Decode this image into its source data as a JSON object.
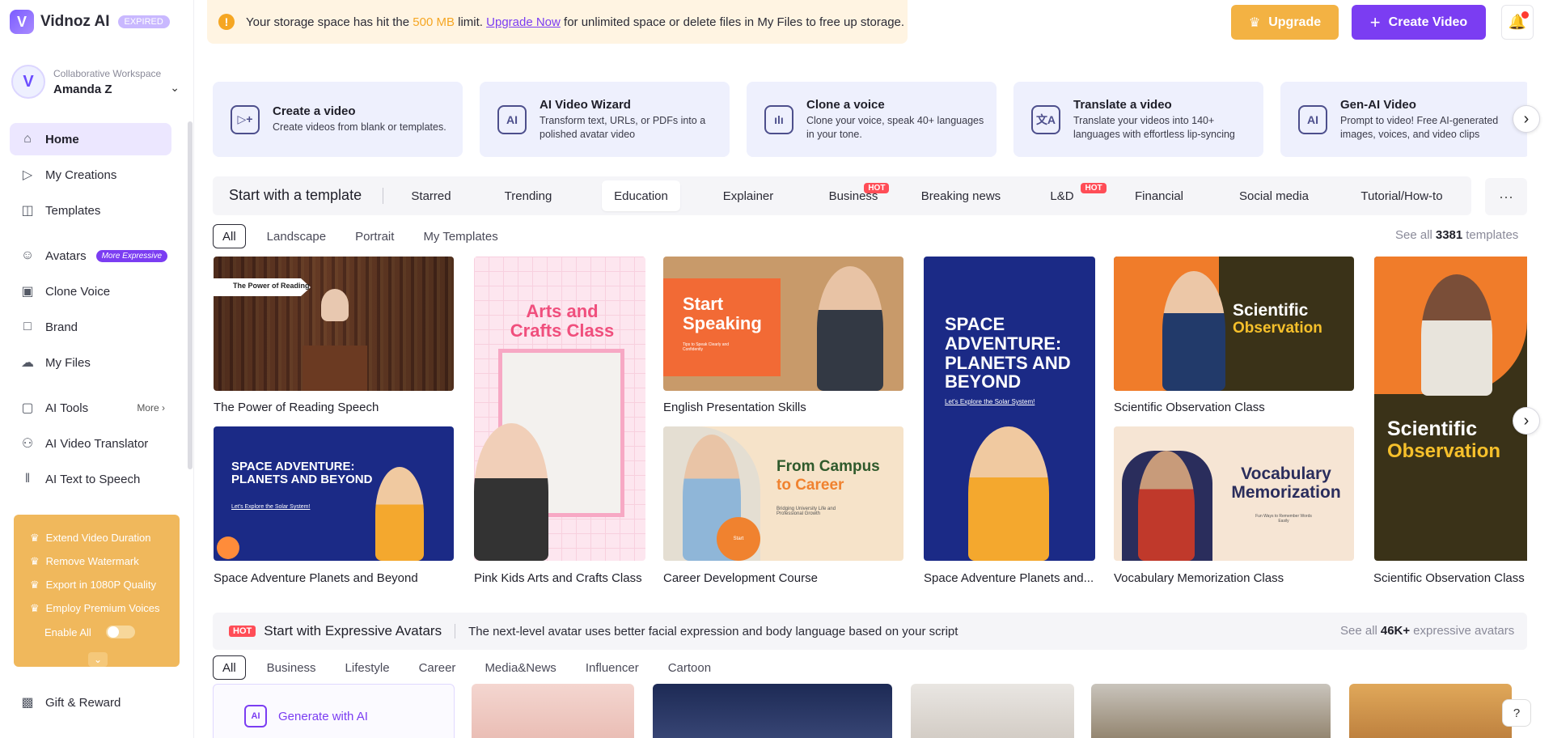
{
  "app": {
    "logo_text": "Vidnoz AI",
    "logo_mark": "V",
    "plan_badge": "EXPIRED",
    "workspace_label": "Collaborative Workspace",
    "workspace_user": "Amanda Z"
  },
  "sidebar": {
    "items": [
      {
        "label": "Home",
        "icon": "home-icon",
        "active": true
      },
      {
        "label": "My Creations",
        "icon": "play-square-icon"
      },
      {
        "label": "Templates",
        "icon": "templates-icon"
      },
      {
        "label": "Avatars",
        "icon": "avatar-icon",
        "badge": "More Expressive"
      },
      {
        "label": "Clone Voice",
        "icon": "voice-clone-icon"
      },
      {
        "label": "Brand",
        "icon": "brand-icon"
      },
      {
        "label": "My Files",
        "icon": "cloud-upload-icon"
      },
      {
        "label": "AI Tools",
        "icon": "ai-tools-icon",
        "more": "More"
      },
      {
        "label": "AI Video Translator",
        "icon": "translate-icon"
      },
      {
        "label": "AI Text to Speech",
        "icon": "waveform-icon"
      }
    ],
    "promo": {
      "items": [
        "Extend Video Duration",
        "Remove Watermark",
        "Export in 1080P Quality",
        "Employ Premium Voices"
      ],
      "toggle_label": "Enable All"
    },
    "gift_label": "Gift & Reward"
  },
  "notice": {
    "text_before": "Your storage space has hit the",
    "limit": "500 MB",
    "text_mid": "limit.",
    "link": "Upgrade Now",
    "text_after": "for unlimited space or delete files in My Files to free up storage."
  },
  "header": {
    "upgrade_label": "Upgrade",
    "create_label": "Create Video"
  },
  "features": [
    {
      "title": "Create a video",
      "desc": "Create videos from blank or templates.",
      "icon": "create-video-icon",
      "glyph": "▷+"
    },
    {
      "title": "AI Video Wizard",
      "desc": "Transform text, URLs, or PDFs into a polished avatar video",
      "icon": "ai-wizard-icon",
      "glyph": "AI"
    },
    {
      "title": "Clone a voice",
      "desc": "Clone your voice, speak 40+ languages in your tone.",
      "icon": "clone-voice-icon",
      "glyph": "ılı"
    },
    {
      "title": "Translate a video",
      "desc": "Translate your videos into 140+ languages with effortless lip-syncing",
      "icon": "translate-video-icon",
      "glyph": "文A"
    },
    {
      "title": "Gen-AI Video",
      "desc": "Prompt to video! Free AI-generated images, voices, and video clips",
      "icon": "gen-ai-video-icon",
      "glyph": "AI"
    }
  ],
  "templates": {
    "section_title": "Start with a template",
    "tabs": [
      {
        "label": "Starred"
      },
      {
        "label": "Trending"
      },
      {
        "label": "Education",
        "active": true
      },
      {
        "label": "Explainer"
      },
      {
        "label": "Business",
        "hot": "HOT"
      },
      {
        "label": "Breaking news"
      },
      {
        "label": "L&D",
        "hot": "HOT"
      },
      {
        "label": "Financial"
      },
      {
        "label": "Social media"
      },
      {
        "label": "Tutorial/How-to"
      }
    ],
    "more_label": "···",
    "filters": [
      "All",
      "Landscape",
      "Portrait",
      "My Templates"
    ],
    "see_all_prefix": "See all",
    "count": "3381",
    "see_all_suffix": "templates",
    "items": [
      {
        "caption": "The Power of Reading Speech",
        "thumb_text": "The Power of Reading"
      },
      {
        "caption": "Space Adventure Planets and Beyond",
        "thumb_text": "SPACE ADVENTURE: PLANETS AND BEYOND",
        "thumb_sub": "Let's Explore the Solar System!"
      },
      {
        "caption": "Pink Kids Arts and Crafts Class",
        "thumb_text": "Arts and Crafts Class"
      },
      {
        "caption": "English Presentation Skills",
        "thumb_text": "Start Speaking",
        "thumb_sub": "Tips to Speak Clearly and Confidently"
      },
      {
        "caption": "Career Development Course",
        "thumb_text": "From Campus",
        "thumb_text2": "to Career",
        "thumb_sub": "Bridging University Life and Professional Growth",
        "thumb_btn": "Start"
      },
      {
        "caption": "Space Adventure Planets and...",
        "thumb_text": "SPACE ADVENTURE: PLANETS AND BEYOND",
        "thumb_sub": "Let's Explore the Solar System!"
      },
      {
        "caption": "Scientific Observation Class",
        "thumb_text": "Scientific",
        "thumb_text2": "Observation"
      },
      {
        "caption": "Vocabulary Memorization Class",
        "thumb_text": "Vocabulary Memorization",
        "thumb_sub": "Fun Ways to Remember Words Easily"
      },
      {
        "caption": "Scientific Observation Class",
        "thumb_text": "Scientific",
        "thumb_text2": "Observation"
      }
    ]
  },
  "avatars": {
    "hot": "HOT",
    "title": "Start with Expressive Avatars",
    "desc": "The next-level avatar uses better facial expression and body language based on your script",
    "see_all_prefix": "See all",
    "count": "46K+",
    "see_all_suffix": "expressive avatars",
    "filters": [
      "All",
      "Business",
      "Lifestyle",
      "Career",
      "Media&News",
      "Influencer",
      "Cartoon"
    ],
    "generate_label": "Generate with AI"
  },
  "colors": {
    "accent": "#7b3df2",
    "upgrade": "#f3b243",
    "hot": "#ff4d57",
    "promo": "#f0b85c"
  }
}
